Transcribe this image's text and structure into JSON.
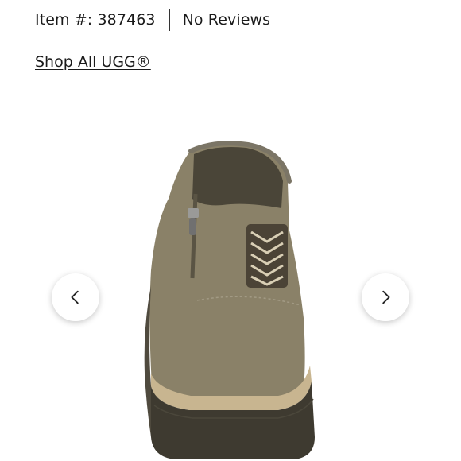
{
  "product": {
    "item_number": "Item #: 387463",
    "reviews": "No Reviews",
    "brand_link": "Shop All UGG®"
  },
  "gallery": {
    "prev_icon": "chevron-left-icon",
    "next_icon": "chevron-right-icon",
    "image_alt": "Olive suede wedge ankle bootie with side zipper, rear view"
  },
  "colors": {
    "suede": "#8a8168",
    "sole": "#3e3a30",
    "welt": "#c8b590",
    "text": "#1a1a1a"
  }
}
